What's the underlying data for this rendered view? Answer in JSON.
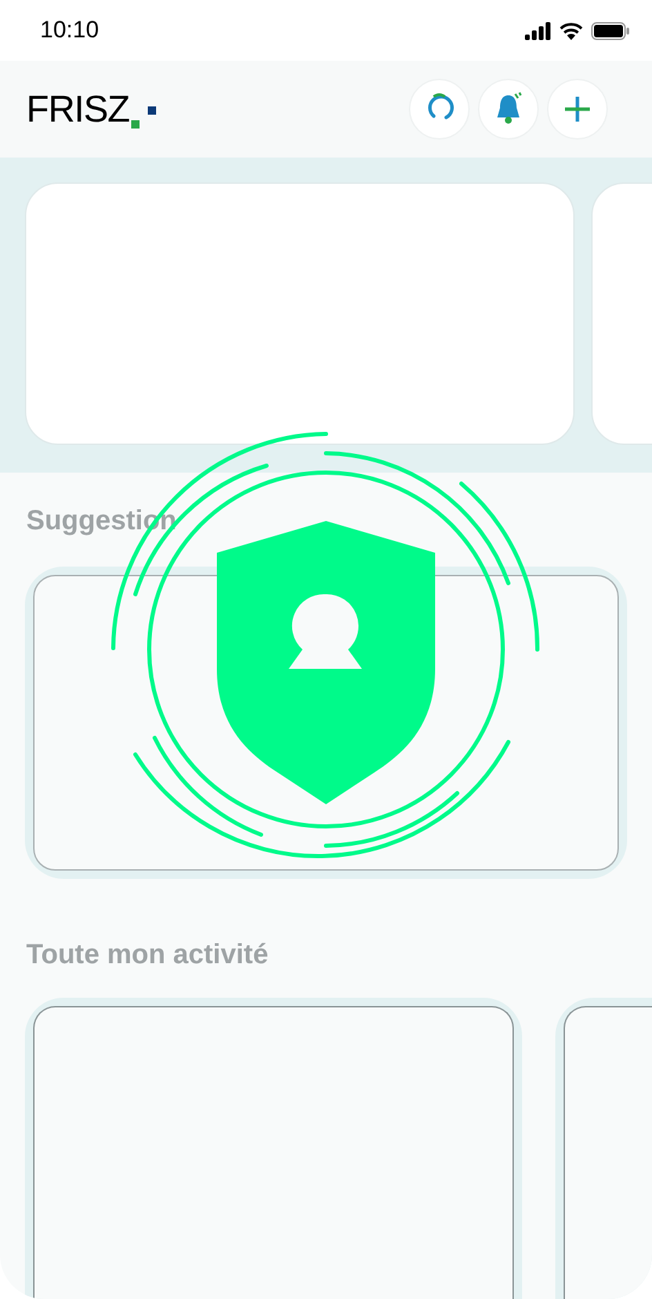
{
  "status_bar": {
    "time": "10:10"
  },
  "header": {
    "logo": "FRISZ"
  },
  "sections": [
    {
      "title": "Suggestion"
    },
    {
      "title": "Toute mon activité"
    }
  ]
}
